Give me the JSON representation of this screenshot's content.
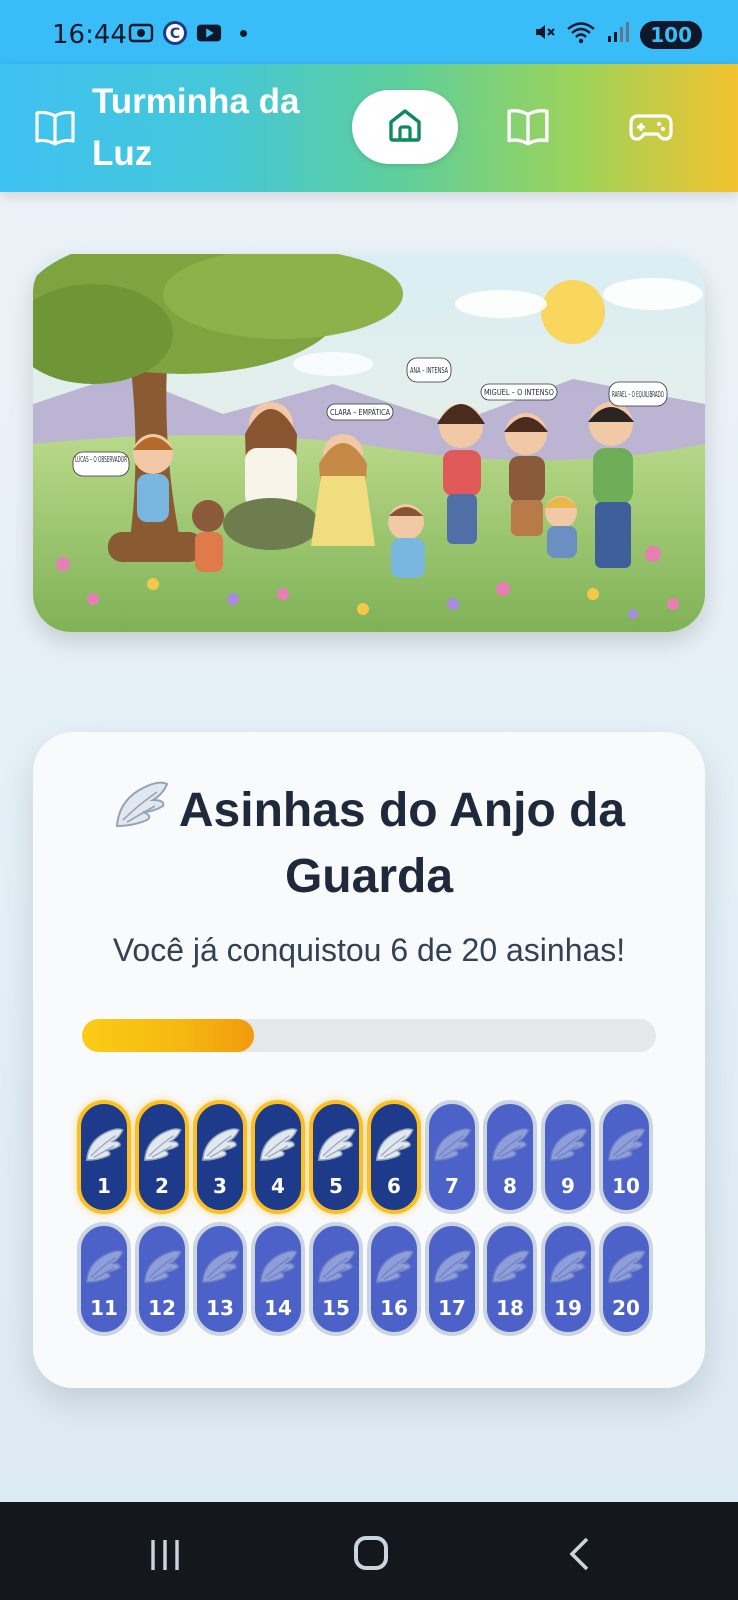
{
  "status_bar": {
    "time": "16:44",
    "battery": "100",
    "icons": [
      "screenshot-icon",
      "c-app-icon",
      "youtube-icon",
      "notification-dot",
      "mute-icon",
      "wifi-icon",
      "signal-icon"
    ]
  },
  "header": {
    "title": "Turminha da Luz",
    "nav": [
      {
        "name": "home",
        "icon": "home-icon",
        "active": true
      },
      {
        "name": "stories",
        "icon": "book-icon",
        "active": false
      },
      {
        "name": "games",
        "icon": "gamepad-icon",
        "active": false
      }
    ],
    "accent": "#38bdf8"
  },
  "hero": {
    "labels": {
      "lucas": "LUCAS – O OBSERVADOR",
      "clara": "CLARA – EMPÁTICA",
      "ana": "ANA – INTENSA",
      "miguel": "MIGUEL – O INTENSO",
      "rafael": "RAFAEL – O EQUILIBRADO"
    }
  },
  "card": {
    "emoji": "🪽",
    "title": "Asinhas do Anjo da Guarda",
    "subtitle": "Você já conquistou 6 de 20 asinhas!",
    "earned": 6,
    "total": 20,
    "progress_fraction": 0.3,
    "badges": [
      "1",
      "2",
      "3",
      "4",
      "5",
      "6",
      "7",
      "8",
      "9",
      "10",
      "11",
      "12",
      "13",
      "14",
      "15",
      "16",
      "17",
      "18",
      "19",
      "20"
    ],
    "colors": {
      "earned_bg": "#1e3a8a",
      "earned_border": "#fbbf24",
      "locked_bg": "#4c62c9",
      "progress": "#facc15"
    }
  }
}
